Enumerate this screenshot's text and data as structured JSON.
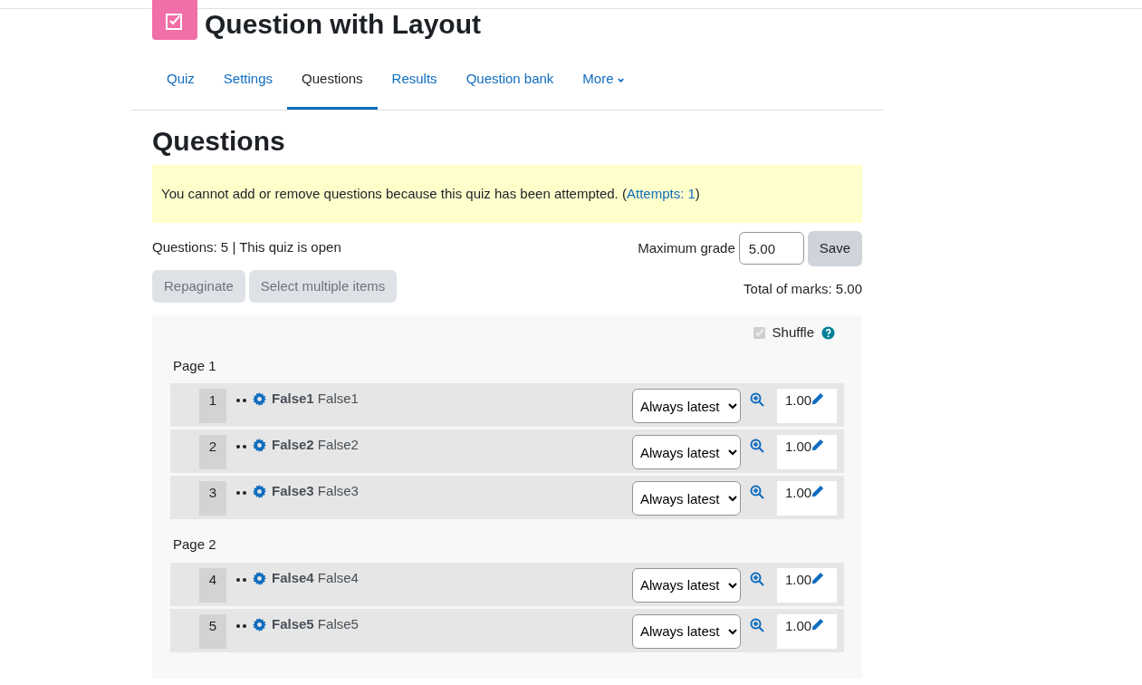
{
  "title": "Question with Layout",
  "tabs": [
    {
      "label": "Quiz",
      "selected": false
    },
    {
      "label": "Settings",
      "selected": false
    },
    {
      "label": "Questions",
      "selected": true
    },
    {
      "label": "Results",
      "selected": false
    },
    {
      "label": "Question bank",
      "selected": false
    },
    {
      "label": "More",
      "selected": false
    }
  ],
  "heading": "Questions",
  "notice": {
    "text": "You cannot add or remove questions because this quiz has been attempted. (",
    "link": "Attempts: 1",
    "after": ")"
  },
  "summary": "Questions: 5 | This quiz is open",
  "max_grade": {
    "label": "Maximum grade",
    "value": "5.00",
    "button": "Save"
  },
  "buttons": [
    "Repaginate",
    "Select multiple items"
  ],
  "total_marks": "Total of marks: 5.00",
  "shuffle": {
    "label": "Shuffle",
    "checked": true,
    "disabled": true
  },
  "pages": [
    {
      "label": "Page 1",
      "questions": [
        {
          "number": "1",
          "name": "**False1** False1",
          "version": "Always latest",
          "mark": "1.00"
        },
        {
          "number": "2",
          "name": "**False2** False2",
          "version": "Always latest",
          "mark": "1.00"
        },
        {
          "number": "3",
          "name": "**False3** False3",
          "version": "Always latest",
          "mark": "1.00"
        }
      ]
    },
    {
      "label": "Page 2",
      "questions": [
        {
          "number": "4",
          "name": "**False4** False4",
          "version": "Always latest",
          "mark": "1.00"
        },
        {
          "number": "5",
          "name": "**False5** False5",
          "version": "Always latest",
          "mark": "1.00"
        }
      ]
    }
  ]
}
